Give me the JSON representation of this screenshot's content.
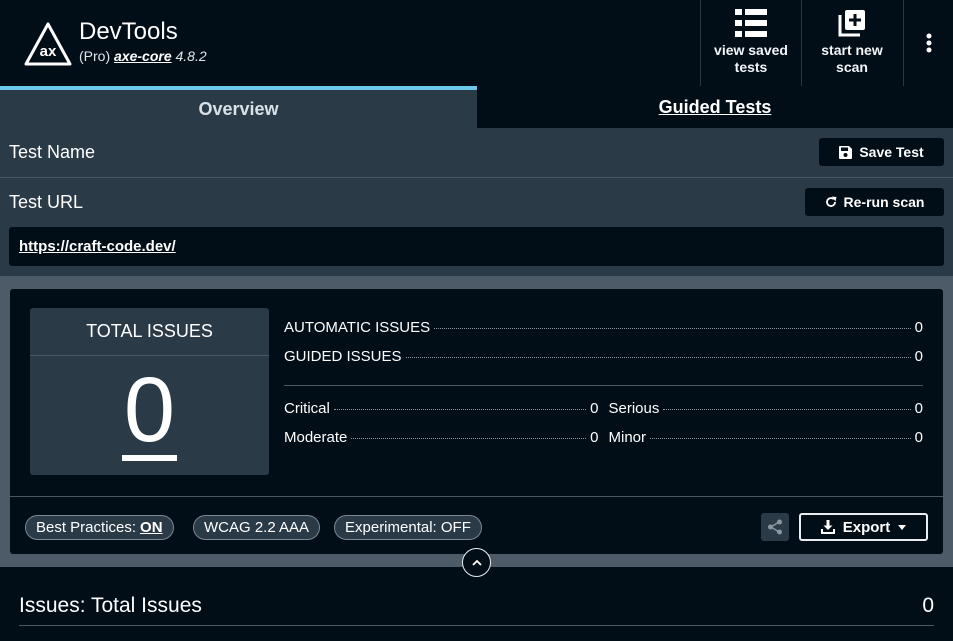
{
  "header": {
    "title": "DevTools",
    "edition": "(Pro)",
    "library": "axe-core",
    "version": "4.8.2",
    "view_saved_label": "view saved tests",
    "start_new_label": "start new scan"
  },
  "tabs": [
    {
      "label": "Overview",
      "active": true
    },
    {
      "label": "Guided Tests",
      "active": false
    }
  ],
  "test": {
    "name_label": "Test Name",
    "save_label": "Save Test",
    "url_label": "Test URL",
    "rerun_label": "Re-run scan",
    "url": "https://craft-code.dev/"
  },
  "summary": {
    "total_title": "TOTAL ISSUES",
    "total": "0",
    "automatic_label": "AUTOMATIC ISSUES",
    "automatic": "0",
    "guided_label": "GUIDED ISSUES",
    "guided": "0",
    "critical_label": "Critical",
    "critical": "0",
    "serious_label": "Serious",
    "serious": "0",
    "moderate_label": "Moderate",
    "moderate": "0",
    "minor_label": "Minor",
    "minor": "0"
  },
  "settings": {
    "best_practices_label": "Best Practices:",
    "best_practices_value": "ON",
    "standard": "WCAG 2.2 AAA",
    "experimental": "Experimental: OFF",
    "export_label": "Export"
  },
  "issues": {
    "title": "Issues: Total Issues",
    "count": "0"
  },
  "colors": {
    "background": "#020e17",
    "panel": "#2a3a47",
    "accent": "#6bc8e9"
  }
}
